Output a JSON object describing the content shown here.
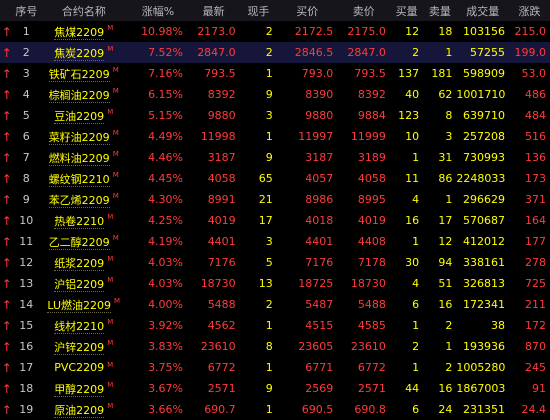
{
  "header": {
    "cols": [
      "序号",
      "合约名称",
      "涨幅%",
      "最新",
      "现手",
      "买价",
      "卖价",
      "买量",
      "卖量",
      "成交量",
      "涨跌"
    ]
  },
  "marker": "M",
  "arrow": "↑",
  "rows": [
    {
      "idx": "1",
      "name": "焦煤2209",
      "pct": "10.98%",
      "last": "2173.0",
      "now": "2",
      "bid": "2172.5",
      "ask": "2175.0",
      "bidv": "12",
      "askv": "18",
      "tot": "103156",
      "chg": "215.0"
    },
    {
      "idx": "2",
      "name": "焦炭2209",
      "pct": "7.52%",
      "last": "2847.0",
      "now": "2",
      "bid": "2846.5",
      "ask": "2847.0",
      "bidv": "2",
      "askv": "1",
      "tot": "57255",
      "chg": "199.0"
    },
    {
      "idx": "3",
      "name": "铁矿石2209",
      "pct": "7.16%",
      "last": "793.5",
      "now": "1",
      "bid": "793.0",
      "ask": "793.5",
      "bidv": "137",
      "askv": "181",
      "tot": "598909",
      "chg": "53.0"
    },
    {
      "idx": "4",
      "name": "棕榈油2209",
      "pct": "6.15%",
      "last": "8392",
      "now": "9",
      "bid": "8390",
      "ask": "8392",
      "bidv": "40",
      "askv": "62",
      "tot": "1001710",
      "chg": "486"
    },
    {
      "idx": "5",
      "name": "豆油2209",
      "pct": "5.15%",
      "last": "9880",
      "now": "3",
      "bid": "9880",
      "ask": "9884",
      "bidv": "123",
      "askv": "8",
      "tot": "639710",
      "chg": "484"
    },
    {
      "idx": "6",
      "name": "菜籽油2209",
      "pct": "4.49%",
      "last": "11998",
      "now": "1",
      "bid": "11997",
      "ask": "11999",
      "bidv": "10",
      "askv": "3",
      "tot": "257208",
      "chg": "516"
    },
    {
      "idx": "7",
      "name": "燃料油2209",
      "pct": "4.46%",
      "last": "3187",
      "now": "9",
      "bid": "3187",
      "ask": "3189",
      "bidv": "1",
      "askv": "31",
      "tot": "730993",
      "chg": "136"
    },
    {
      "idx": "8",
      "name": "螺纹钢2210",
      "pct": "4.45%",
      "last": "4058",
      "now": "65",
      "bid": "4057",
      "ask": "4058",
      "bidv": "11",
      "askv": "86",
      "tot": "2248033",
      "chg": "173"
    },
    {
      "idx": "9",
      "name": "苯乙烯2209",
      "pct": "4.30%",
      "last": "8991",
      "now": "21",
      "bid": "8986",
      "ask": "8995",
      "bidv": "4",
      "askv": "1",
      "tot": "296629",
      "chg": "371"
    },
    {
      "idx": "10",
      "name": "热卷2210",
      "pct": "4.25%",
      "last": "4019",
      "now": "17",
      "bid": "4018",
      "ask": "4019",
      "bidv": "16",
      "askv": "17",
      "tot": "570687",
      "chg": "164"
    },
    {
      "idx": "11",
      "name": "乙二醇2209",
      "pct": "4.19%",
      "last": "4401",
      "now": "3",
      "bid": "4401",
      "ask": "4408",
      "bidv": "1",
      "askv": "12",
      "tot": "412012",
      "chg": "177"
    },
    {
      "idx": "12",
      "name": "纸浆2209",
      "pct": "4.03%",
      "last": "7176",
      "now": "5",
      "bid": "7176",
      "ask": "7178",
      "bidv": "30",
      "askv": "94",
      "tot": "338161",
      "chg": "278"
    },
    {
      "idx": "13",
      "name": "沪铝2209",
      "pct": "4.03%",
      "last": "18730",
      "now": "13",
      "bid": "18725",
      "ask": "18730",
      "bidv": "4",
      "askv": "51",
      "tot": "326813",
      "chg": "725"
    },
    {
      "idx": "14",
      "name": "LU燃油2209",
      "pct": "4.00%",
      "last": "5488",
      "now": "2",
      "bid": "5487",
      "ask": "5488",
      "bidv": "6",
      "askv": "16",
      "tot": "172341",
      "chg": "211"
    },
    {
      "idx": "15",
      "name": "线材2210",
      "pct": "3.92%",
      "last": "4562",
      "now": "1",
      "bid": "4515",
      "ask": "4585",
      "bidv": "1",
      "askv": "2",
      "tot": "38",
      "chg": "172"
    },
    {
      "idx": "16",
      "name": "沪锌2209",
      "pct": "3.83%",
      "last": "23610",
      "now": "8",
      "bid": "23605",
      "ask": "23610",
      "bidv": "2",
      "askv": "1",
      "tot": "193936",
      "chg": "870"
    },
    {
      "idx": "17",
      "name": "PVC2209",
      "pct": "3.75%",
      "last": "6772",
      "now": "1",
      "bid": "6771",
      "ask": "6772",
      "bidv": "1",
      "askv": "2",
      "tot": "1005280",
      "chg": "245"
    },
    {
      "idx": "18",
      "name": "甲醇2209",
      "pct": "3.67%",
      "last": "2571",
      "now": "9",
      "bid": "2569",
      "ask": "2571",
      "bidv": "44",
      "askv": "16",
      "tot": "1867003",
      "chg": "91"
    },
    {
      "idx": "19",
      "name": "原油2209",
      "pct": "3.66%",
      "last": "690.7",
      "now": "1",
      "bid": "690.5",
      "ask": "690.8",
      "bidv": "6",
      "askv": "24",
      "tot": "231351",
      "chg": "24.4"
    }
  ]
}
